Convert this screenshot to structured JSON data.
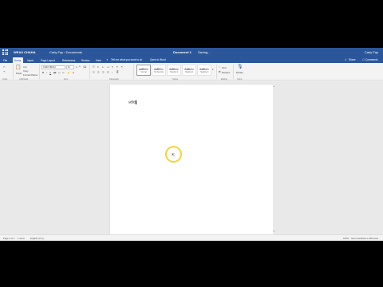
{
  "titlebar": {
    "app_name": "WEAX CHAHA",
    "breadcrumb": "Carly Fay › Documents",
    "doc_title": "Document 1",
    "status": "Saving...",
    "user": "Carly Fay"
  },
  "tabs": [
    "File",
    "Home",
    "Insert",
    "Page Layout",
    "References",
    "Review",
    "View"
  ],
  "tell_me": "Tell me what you want to do",
  "open_in_word": "Open in Word",
  "share_label": "Share",
  "comments_label": "Comments",
  "ribbon": {
    "undo_group": "Undo",
    "clipboard": {
      "paste": "Paste",
      "cut": "Cut",
      "copy": "Copy",
      "format_painter": "Format Painter",
      "label": "Clipboard"
    },
    "font": {
      "name": "Calibri (Body)",
      "size": "11",
      "label": "Font"
    },
    "paragraph_label": "Paragraph",
    "styles": {
      "label": "Styles",
      "items": [
        {
          "sample": "AaBbCc",
          "name": "Normal"
        },
        {
          "sample": "AaBbCc",
          "name": "No Spacing"
        },
        {
          "sample": "AaBbCc",
          "name": "Heading 1"
        },
        {
          "sample": "AaBbCc",
          "name": "Heading 2"
        },
        {
          "sample": "AaBbCc",
          "name": "Heading 3"
        }
      ]
    },
    "editing": {
      "find": "Find",
      "replace": "Replace",
      "label": "Editing"
    },
    "dictate": "Dictate",
    "voice_label": "Voice"
  },
  "document": {
    "body_text": "sdfd"
  },
  "statusbar": {
    "page": "Page 1 of 1",
    "words": "1 word",
    "language": "English (U.S.)",
    "zoom": "100%",
    "feedback": "Give Feedback to Microsoft"
  }
}
